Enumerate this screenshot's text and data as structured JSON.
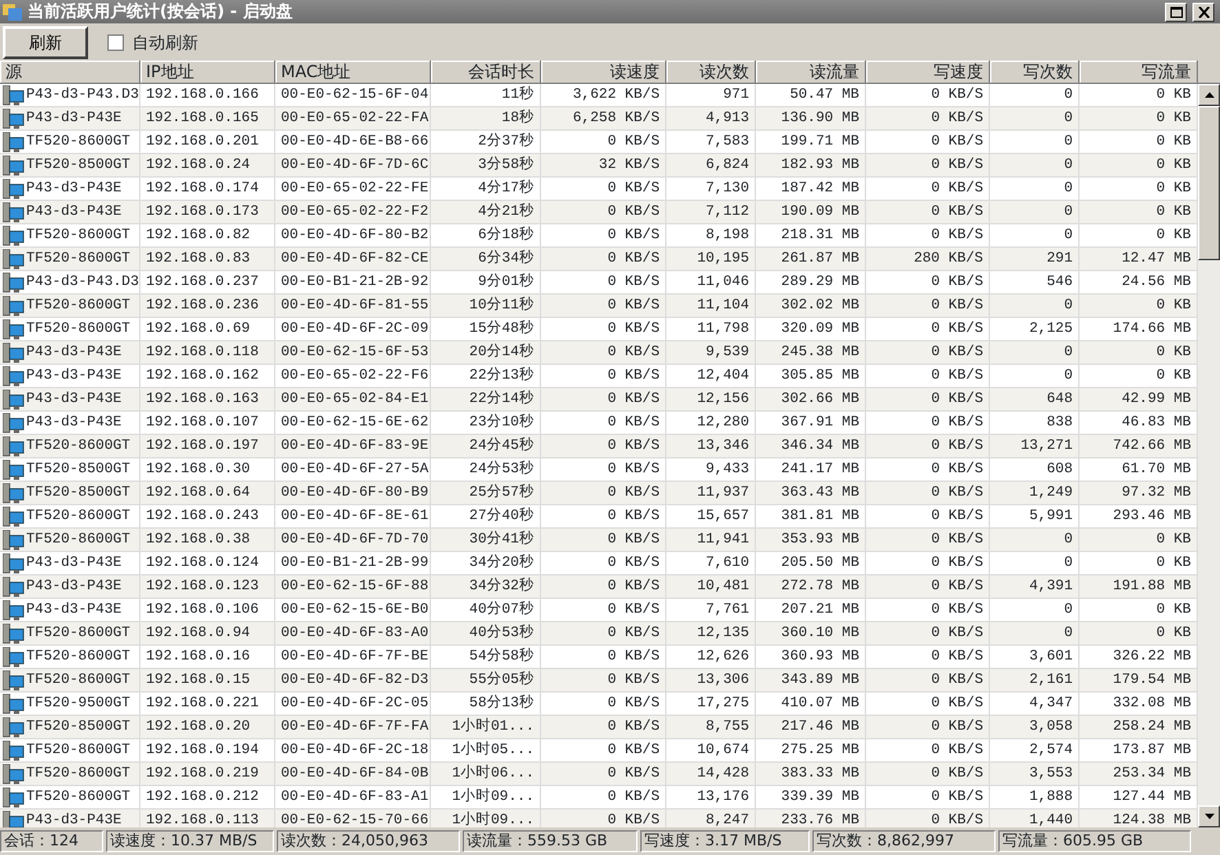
{
  "window": {
    "title": "当前活跃用户统计(按会话) - 启动盘"
  },
  "toolbar": {
    "refresh_button": "刷新",
    "auto_refresh": {
      "label": "自动刷新",
      "checked": false
    }
  },
  "table": {
    "columns": [
      {
        "label": "源",
        "kind": "text"
      },
      {
        "label": "IP地址",
        "kind": "text"
      },
      {
        "label": "MAC地址",
        "kind": "text"
      },
      {
        "label": "会话时长",
        "kind": "number"
      },
      {
        "label": "读速度",
        "kind": "number"
      },
      {
        "label": "读次数",
        "kind": "number"
      },
      {
        "label": "读流量",
        "kind": "number"
      },
      {
        "label": "写速度",
        "kind": "number"
      },
      {
        "label": "写次数",
        "kind": "number"
      },
      {
        "label": "写流量",
        "kind": "number"
      }
    ],
    "rows": [
      [
        "P43-d3-P43.D3",
        "192.168.0.166",
        "00-E0-62-15-6F-04",
        "11秒",
        "3,622 KB/S",
        "971",
        "50.47 MB",
        "0 KB/S",
        "0",
        "0 KB"
      ],
      [
        "P43-d3-P43E",
        "192.168.0.165",
        "00-E0-65-02-22-FA",
        "18秒",
        "6,258 KB/S",
        "4,913",
        "136.90 MB",
        "0 KB/S",
        "0",
        "0 KB"
      ],
      [
        "TF520-8600GT",
        "192.168.0.201",
        "00-E0-4D-6E-B8-66",
        "2分37秒",
        "0 KB/S",
        "7,583",
        "199.71 MB",
        "0 KB/S",
        "0",
        "0 KB"
      ],
      [
        "TF520-8500GT",
        "192.168.0.24",
        "00-E0-4D-6F-7D-6C",
        "3分58秒",
        "32 KB/S",
        "6,824",
        "182.93 MB",
        "0 KB/S",
        "0",
        "0 KB"
      ],
      [
        "P43-d3-P43E",
        "192.168.0.174",
        "00-E0-65-02-22-FE",
        "4分17秒",
        "0 KB/S",
        "7,130",
        "187.42 MB",
        "0 KB/S",
        "0",
        "0 KB"
      ],
      [
        "P43-d3-P43E",
        "192.168.0.173",
        "00-E0-65-02-22-F2",
        "4分21秒",
        "0 KB/S",
        "7,112",
        "190.09 MB",
        "0 KB/S",
        "0",
        "0 KB"
      ],
      [
        "TF520-8600GT",
        "192.168.0.82",
        "00-E0-4D-6F-80-B2",
        "6分18秒",
        "0 KB/S",
        "8,198",
        "218.31 MB",
        "0 KB/S",
        "0",
        "0 KB"
      ],
      [
        "TF520-8600GT",
        "192.168.0.83",
        "00-E0-4D-6F-82-CE",
        "6分34秒",
        "0 KB/S",
        "10,195",
        "261.87 MB",
        "280 KB/S",
        "291",
        "12.47 MB"
      ],
      [
        "P43-d3-P43.D3",
        "192.168.0.237",
        "00-E0-B1-21-2B-92",
        "9分01秒",
        "0 KB/S",
        "11,046",
        "289.29 MB",
        "0 KB/S",
        "546",
        "24.56 MB"
      ],
      [
        "TF520-8600GT",
        "192.168.0.236",
        "00-E0-4D-6F-81-55",
        "10分11秒",
        "0 KB/S",
        "11,104",
        "302.02 MB",
        "0 KB/S",
        "0",
        "0 KB"
      ],
      [
        "TF520-8600GT",
        "192.168.0.69",
        "00-E0-4D-6F-2C-09",
        "15分48秒",
        "0 KB/S",
        "11,798",
        "320.09 MB",
        "0 KB/S",
        "2,125",
        "174.66 MB"
      ],
      [
        "P43-d3-P43E",
        "192.168.0.118",
        "00-E0-62-15-6F-53",
        "20分14秒",
        "0 KB/S",
        "9,539",
        "245.38 MB",
        "0 KB/S",
        "0",
        "0 KB"
      ],
      [
        "P43-d3-P43E",
        "192.168.0.162",
        "00-E0-65-02-22-F6",
        "22分13秒",
        "0 KB/S",
        "12,404",
        "305.85 MB",
        "0 KB/S",
        "0",
        "0 KB"
      ],
      [
        "P43-d3-P43E",
        "192.168.0.163",
        "00-E0-65-02-84-E1",
        "22分14秒",
        "0 KB/S",
        "12,156",
        "302.66 MB",
        "0 KB/S",
        "648",
        "42.99 MB"
      ],
      [
        "P43-d3-P43E",
        "192.168.0.107",
        "00-E0-62-15-6E-62",
        "23分10秒",
        "0 KB/S",
        "12,280",
        "367.91 MB",
        "0 KB/S",
        "838",
        "46.83 MB"
      ],
      [
        "TF520-8600GT",
        "192.168.0.197",
        "00-E0-4D-6F-83-9E",
        "24分45秒",
        "0 KB/S",
        "13,346",
        "346.34 MB",
        "0 KB/S",
        "13,271",
        "742.66 MB"
      ],
      [
        "TF520-8500GT",
        "192.168.0.30",
        "00-E0-4D-6F-27-5A",
        "24分53秒",
        "0 KB/S",
        "9,433",
        "241.17 MB",
        "0 KB/S",
        "608",
        "61.70 MB"
      ],
      [
        "TF520-8500GT",
        "192.168.0.64",
        "00-E0-4D-6F-80-B9",
        "25分57秒",
        "0 KB/S",
        "11,937",
        "363.43 MB",
        "0 KB/S",
        "1,249",
        "97.32 MB"
      ],
      [
        "TF520-8600GT",
        "192.168.0.243",
        "00-E0-4D-6F-8E-61",
        "27分40秒",
        "0 KB/S",
        "15,657",
        "381.81 MB",
        "0 KB/S",
        "5,991",
        "293.46 MB"
      ],
      [
        "TF520-8600GT",
        "192.168.0.38",
        "00-E0-4D-6F-7D-70",
        "30分41秒",
        "0 KB/S",
        "11,941",
        "353.93 MB",
        "0 KB/S",
        "0",
        "0 KB"
      ],
      [
        "P43-d3-P43E",
        "192.168.0.124",
        "00-E0-B1-21-2B-99",
        "34分20秒",
        "0 KB/S",
        "7,610",
        "205.50 MB",
        "0 KB/S",
        "0",
        "0 KB"
      ],
      [
        "P43-d3-P43E",
        "192.168.0.123",
        "00-E0-62-15-6F-88",
        "34分32秒",
        "0 KB/S",
        "10,481",
        "272.78 MB",
        "0 KB/S",
        "4,391",
        "191.88 MB"
      ],
      [
        "P43-d3-P43E",
        "192.168.0.106",
        "00-E0-62-15-6E-B0",
        "40分07秒",
        "0 KB/S",
        "7,761",
        "207.21 MB",
        "0 KB/S",
        "0",
        "0 KB"
      ],
      [
        "TF520-8600GT",
        "192.168.0.94",
        "00-E0-4D-6F-83-A0",
        "40分53秒",
        "0 KB/S",
        "12,135",
        "360.10 MB",
        "0 KB/S",
        "0",
        "0 KB"
      ],
      [
        "TF520-8600GT",
        "192.168.0.16",
        "00-E0-4D-6F-7F-BE",
        "54分58秒",
        "0 KB/S",
        "12,626",
        "360.93 MB",
        "0 KB/S",
        "3,601",
        "326.22 MB"
      ],
      [
        "TF520-8600GT",
        "192.168.0.15",
        "00-E0-4D-6F-82-D3",
        "55分05秒",
        "0 KB/S",
        "13,306",
        "343.89 MB",
        "0 KB/S",
        "2,161",
        "179.54 MB"
      ],
      [
        "TF520-9500GT",
        "192.168.0.221",
        "00-E0-4D-6F-2C-05",
        "58分13秒",
        "0 KB/S",
        "17,275",
        "410.07 MB",
        "0 KB/S",
        "4,347",
        "332.08 MB"
      ],
      [
        "TF520-8500GT",
        "192.168.0.20",
        "00-E0-4D-6F-7F-FA",
        "1小时01...",
        "0 KB/S",
        "8,755",
        "217.46 MB",
        "0 KB/S",
        "3,058",
        "258.24 MB"
      ],
      [
        "TF520-8600GT",
        "192.168.0.194",
        "00-E0-4D-6F-2C-18",
        "1小时05...",
        "0 KB/S",
        "10,674",
        "275.25 MB",
        "0 KB/S",
        "2,574",
        "173.87 MB"
      ],
      [
        "TF520-8600GT",
        "192.168.0.219",
        "00-E0-4D-6F-84-0B",
        "1小时06...",
        "0 KB/S",
        "14,428",
        "383.33 MB",
        "0 KB/S",
        "3,553",
        "253.34 MB"
      ],
      [
        "TF520-8600GT",
        "192.168.0.212",
        "00-E0-4D-6F-83-A1",
        "1小时09...",
        "0 KB/S",
        "13,176",
        "339.39 MB",
        "0 KB/S",
        "1,888",
        "127.44 MB"
      ],
      [
        "P43-d3-P43E",
        "192.168.0.113",
        "00-E0-62-15-70-66",
        "1小时09...",
        "0 KB/S",
        "8,247",
        "233.76 MB",
        "0 KB/S",
        "1,440",
        "124.38 MB"
      ]
    ]
  },
  "status_bar": [
    "会话：124",
    "读速度：10.37 MB/S",
    "读次数：24,050,963",
    "读流量：559.53 GB",
    "写速度：3.17 MB/S",
    "写次数：8,862,997",
    "写流量：605.95 GB"
  ]
}
